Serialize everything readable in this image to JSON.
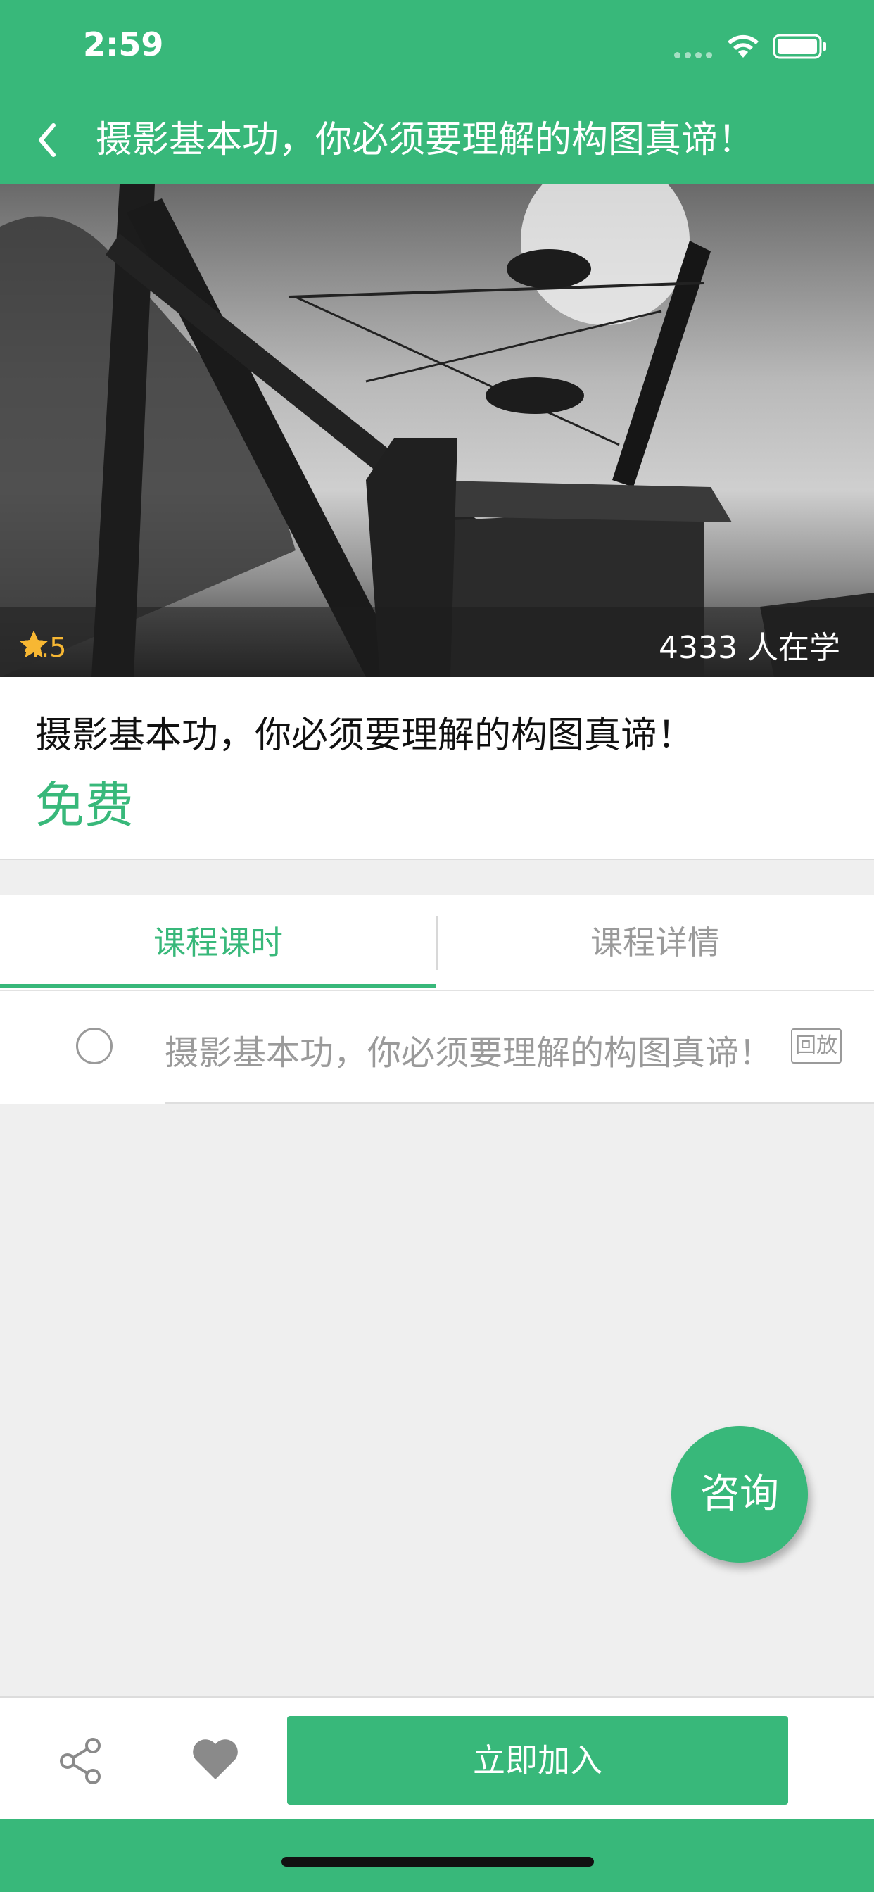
{
  "status_bar": {
    "time": "2:59"
  },
  "nav": {
    "title": "摄影基本功，你必须要理解的构图真谛！"
  },
  "hero": {
    "rating": "4.5",
    "stars_filled": 5,
    "learners": "4333 人在学"
  },
  "course": {
    "title": "摄影基本功，你必须要理解的构图真谛！",
    "price": "免费"
  },
  "tabs": [
    {
      "label": "课程课时",
      "active": true
    },
    {
      "label": "课程详情",
      "active": false
    }
  ],
  "lessons": [
    {
      "title": "摄影基本功，你必须要理解的构图真谛！",
      "badge": "回放"
    }
  ],
  "consult_label": "咨询",
  "bottom_bar": {
    "join_label": "立即加入"
  },
  "icons": {
    "back": "chevron-left-icon",
    "share": "share-icon",
    "favorite": "heart-icon",
    "star": "star-icon"
  },
  "colors": {
    "brand": "#38b87a",
    "star": "#f7b733",
    "muted": "#9a9a9a"
  }
}
